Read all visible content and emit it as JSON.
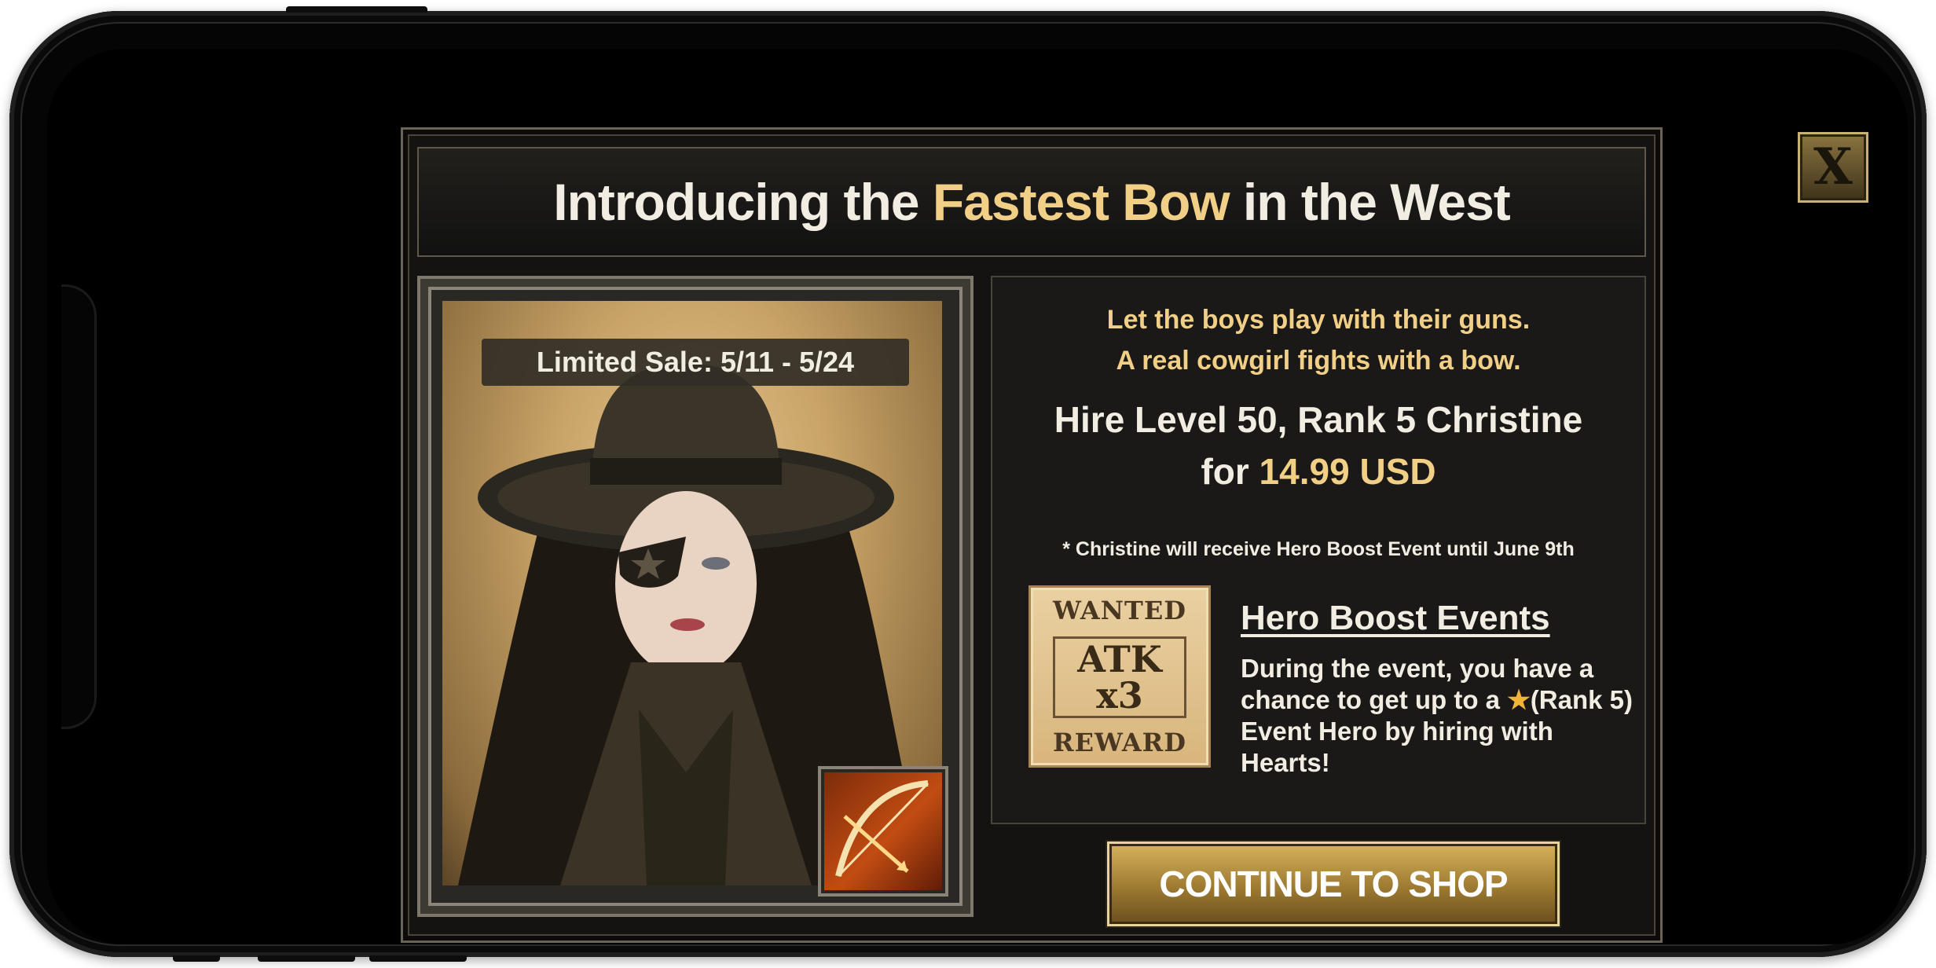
{
  "dialog": {
    "title_pre": "Introducing the ",
    "title_highlight": "Fastest Bow",
    "title_post": " in the West",
    "sale_label": "Limited Sale: 5/11 - 5/24",
    "tagline_1": "Let the boys play with their guns.",
    "tagline_2": "A real cowgirl fights with a bow.",
    "hire_line_1": "Hire Level 50, Rank 5 Christine",
    "hire_for": "for ",
    "hire_price": "14.99 USD",
    "note": "* Christine will receive Hero Boost Event until June 9th",
    "poster": {
      "top": "WANTED",
      "line1": "ATK",
      "line2": "x3",
      "bottom": "REWARD"
    },
    "hero_boost_title": "Hero Boost Events",
    "hero_boost_body_1": "During the event, you have a chance to get up to a ",
    "hero_boost_body_2": "(Rank 5) Event Hero by hiring with Hearts!",
    "continue_label": "CONTINUE TO SHOP",
    "close_label": "X"
  },
  "icons": {
    "close": "close-icon",
    "star": "star-icon",
    "bow": "bow-icon"
  },
  "colors": {
    "accent_gold": "#f1cf86",
    "text": "#f2ede2",
    "panel": "#141311"
  }
}
